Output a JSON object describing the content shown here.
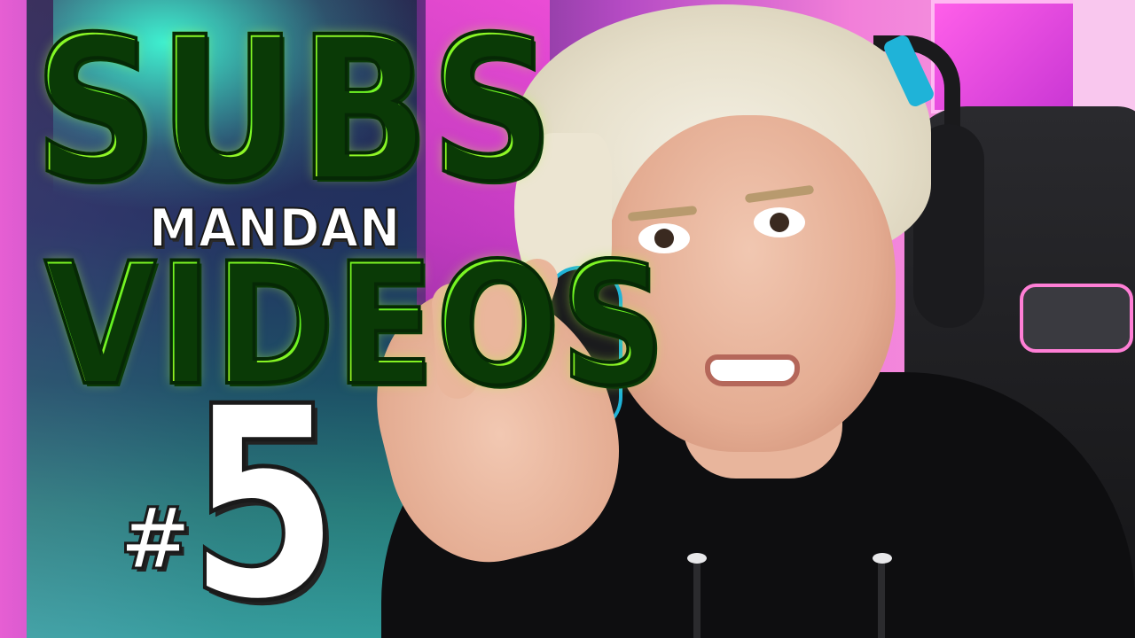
{
  "thumbnail": {
    "title_line_1": "SUBS",
    "title_line_2": "MANDAN",
    "title_line_3": "VIDEOS",
    "episode_prefix": "#",
    "episode_number": "5"
  },
  "colors": {
    "title_green": "#3af51a",
    "title_yellow_green": "#c9f31a",
    "episode_white": "#ffffff",
    "background_magenta": "#e65fd3",
    "background_teal": "#2ab0a0",
    "hoodie_black": "#0e0e10",
    "headset_accent_blue": "#1fb3d8"
  }
}
